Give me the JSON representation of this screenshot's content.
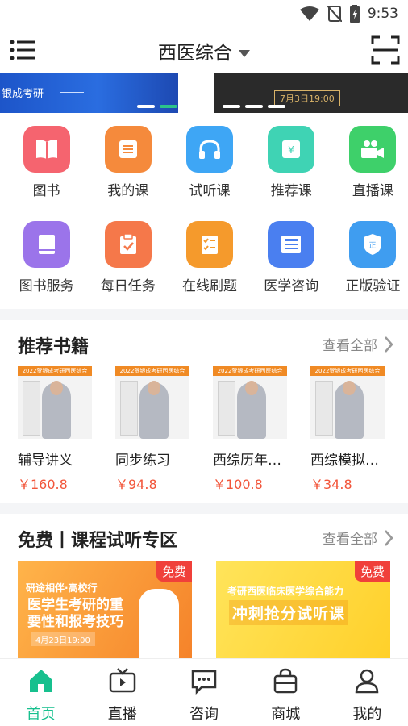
{
  "status_bar": {
    "time": "9:53"
  },
  "header": {
    "title": "西医综合"
  },
  "banner": {
    "left_text": "银成考研",
    "right_date": "7月3日19:00"
  },
  "quick_icons_row1": [
    {
      "label": "图书",
      "icon": "book-icon",
      "color": "#f5646f"
    },
    {
      "label": "我的课",
      "icon": "course-list-icon",
      "color": "#f58a3c"
    },
    {
      "label": "试听课",
      "icon": "headphones-icon",
      "color": "#3ea6f5"
    },
    {
      "label": "推荐课",
      "icon": "recommend-icon",
      "color": "#3fd3b4"
    },
    {
      "label": "直播课",
      "icon": "video-camera-icon",
      "color": "#3ed06a"
    }
  ],
  "quick_icons_row2": [
    {
      "label": "图书服务",
      "icon": "book-service-icon",
      "color": "#9b74ea"
    },
    {
      "label": "每日任务",
      "icon": "daily-task-icon",
      "color": "#f5784a"
    },
    {
      "label": "在线刷题",
      "icon": "quiz-icon",
      "color": "#f59a2c"
    },
    {
      "label": "医学咨询",
      "icon": "article-icon",
      "color": "#4a7ff0"
    },
    {
      "label": "正版验证",
      "icon": "shield-icon",
      "color": "#3f9df0"
    }
  ],
  "books_section": {
    "title": "推荐书籍",
    "see_all": "查看全部",
    "items": [
      {
        "name": "辅导讲义",
        "price": "￥160.8",
        "cover_band": "2022贺银成考研西医综合"
      },
      {
        "name": "同步练习",
        "price": "￥94.8",
        "cover_band": "2022贺银成考研西医综合"
      },
      {
        "name": "西综历年…",
        "price": "￥100.8",
        "cover_band": "2022贺银成考研西医综合"
      },
      {
        "name": "西综模拟…",
        "price": "￥34.8",
        "cover_band": "2022贺银成考研西医综合"
      }
    ]
  },
  "courses_section": {
    "title": "免费丨课程试听专区",
    "see_all": "查看全部",
    "items": [
      {
        "tag": "免费",
        "top": "研途相伴·高校行",
        "main": "医学生考研的重要性和报考技巧",
        "date": "4月23日19:00"
      },
      {
        "tag": "免费",
        "top": "考研西医临床医学综合能力",
        "main": "冲刺抢分试听课"
      }
    ]
  },
  "tab_bar": {
    "items": [
      {
        "label": "首页",
        "icon": "home-icon",
        "active": true
      },
      {
        "label": "直播",
        "icon": "tv-icon",
        "active": false
      },
      {
        "label": "咨询",
        "icon": "chat-icon",
        "active": false
      },
      {
        "label": "商城",
        "icon": "shopping-bag-icon",
        "active": false
      },
      {
        "label": "我的",
        "icon": "profile-icon",
        "active": false
      }
    ]
  },
  "colors": {
    "accent": "#17c08e",
    "price": "#f2553a",
    "free_tag": "#f0403a"
  }
}
